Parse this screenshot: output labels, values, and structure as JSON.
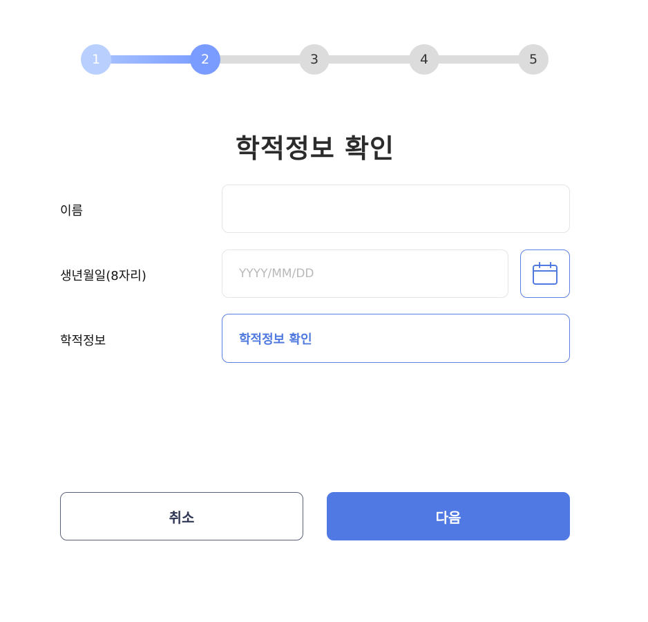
{
  "stepper": {
    "steps": [
      "1",
      "2",
      "3",
      "4",
      "5"
    ],
    "current_step": 2
  },
  "page_title": "학적정보 확인",
  "form": {
    "name": {
      "label": "이름",
      "value": "",
      "placeholder": ""
    },
    "birthdate": {
      "label": "생년월일(8자리)",
      "value": "",
      "placeholder": "YYYY/MM/DD",
      "calendar_icon": "calendar-icon"
    },
    "academic": {
      "label": "학적정보",
      "button_label": "학적정보 확인"
    }
  },
  "actions": {
    "cancel_label": "취소",
    "next_label": "다음"
  },
  "colors": {
    "accent": "#5079e3",
    "step_done": "#b9d0ff",
    "step_current": "#7a9bff",
    "step_pending": "#dcdcdc"
  }
}
